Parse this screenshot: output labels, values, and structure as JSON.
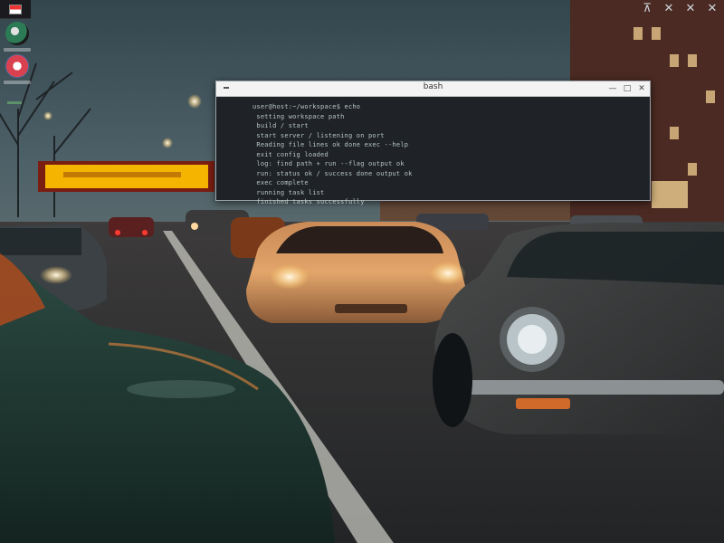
{
  "desktop": {
    "icons": [
      {
        "name": "app-icon-1",
        "color": "#2c7a56"
      },
      {
        "name": "app-icon-2",
        "color": "#d94050"
      }
    ],
    "corner_controls": [
      "⊼",
      "✕",
      "✕",
      "✕"
    ]
  },
  "terminal": {
    "title": "bash",
    "controls": [
      "—",
      "□",
      "✕"
    ],
    "lines": [
      {
        "gutter": "",
        "text": "user@host:~/workspace$ echo"
      },
      {
        "gutter": "",
        "text": "  setting workspace path"
      },
      {
        "gutter": "",
        "text": "  build / start"
      },
      {
        "gutter": "",
        "text": "  start server / listening on port"
      },
      {
        "gutter": "",
        "text": "  Reading file  lines  ok  done  exec  --help"
      },
      {
        "gutter": "",
        "text": "  exit config loaded"
      },
      {
        "gutter": "",
        "text": "  log: find path + run  --flag  output  ok"
      },
      {
        "gutter": "",
        "text": "  run: status  ok  /  success  done output ok"
      },
      {
        "gutter": "",
        "text": "  exec complete"
      },
      {
        "gutter": "",
        "text": "  running  task  list"
      },
      {
        "gutter": "",
        "text": "  finished tasks successfully"
      }
    ]
  },
  "colors": {
    "sky": "#3b4c52",
    "road": "#2b2c2e",
    "sign": "#f4b400",
    "car_orange": "#d9955a",
    "car_gray": "#3d3f40",
    "car_green": "#1f3a33"
  }
}
